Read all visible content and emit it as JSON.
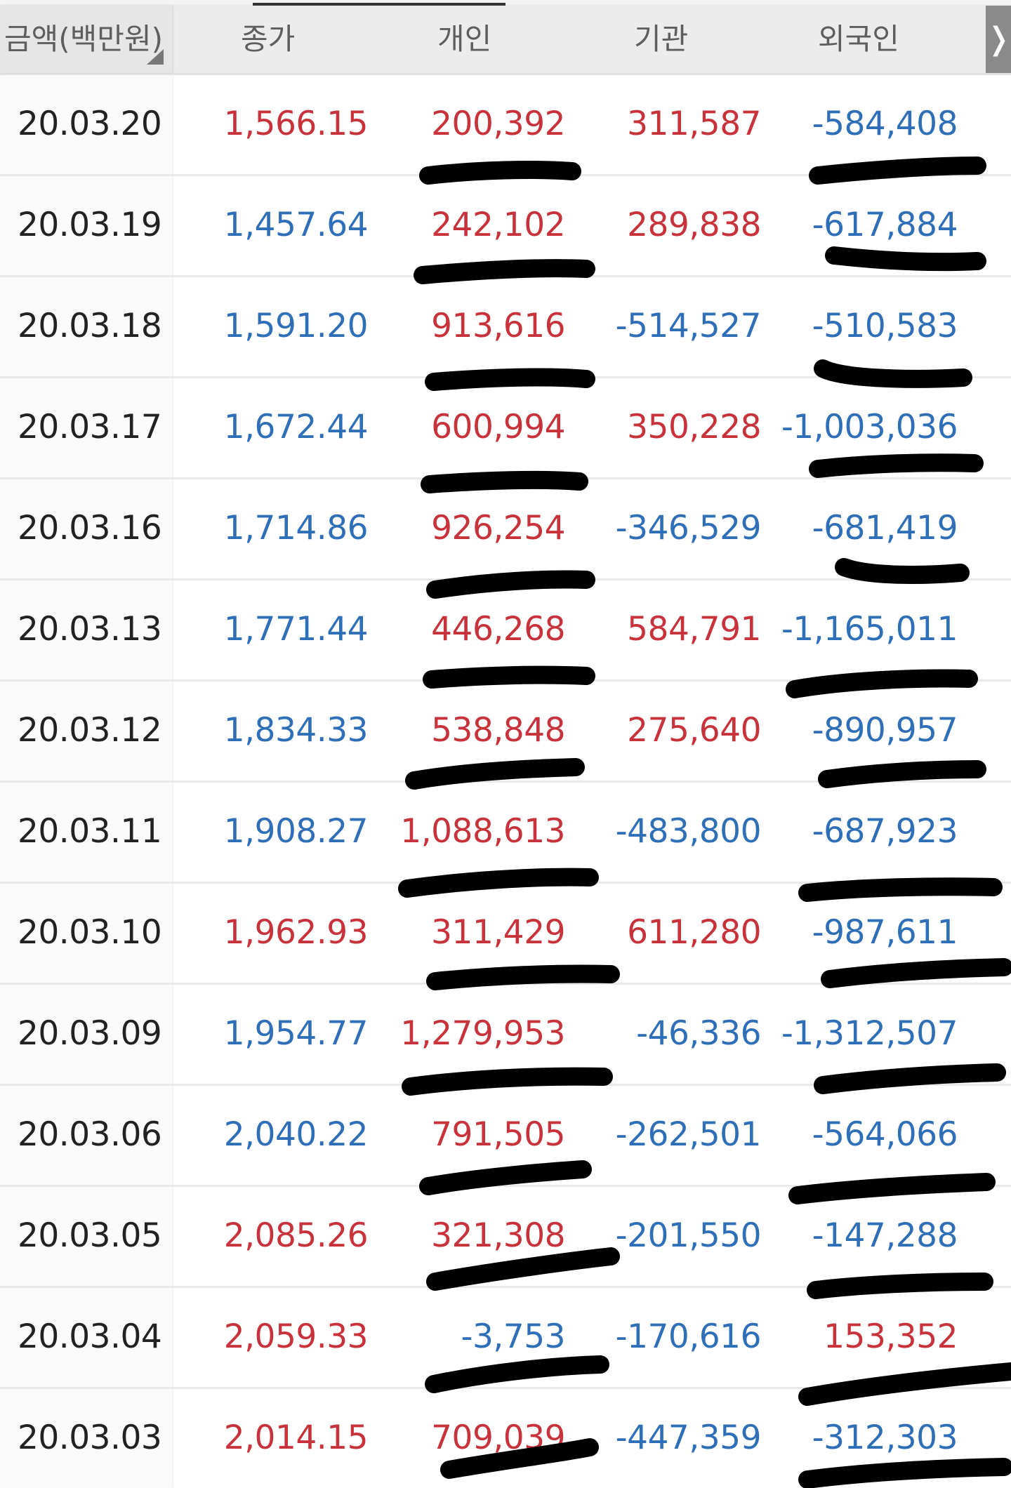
{
  "header": {
    "columns": [
      "금액(백만원)",
      "종가",
      "개인",
      "기관",
      "외국인"
    ],
    "next_glyph": "❭"
  },
  "rows": [
    {
      "date": "20.03.20",
      "close": "1,566.15",
      "individual": "200,392",
      "institution": "311,587",
      "foreign": "-584,408",
      "close_color": "red",
      "individual_color": "red",
      "institution_color": "red",
      "foreign_color": "blue"
    },
    {
      "date": "20.03.19",
      "close": "1,457.64",
      "individual": "242,102",
      "institution": "289,838",
      "foreign": "-617,884",
      "close_color": "blue",
      "individual_color": "red",
      "institution_color": "red",
      "foreign_color": "blue"
    },
    {
      "date": "20.03.18",
      "close": "1,591.20",
      "individual": "913,616",
      "institution": "-514,527",
      "foreign": "-510,583",
      "close_color": "blue",
      "individual_color": "red",
      "institution_color": "blue",
      "foreign_color": "blue"
    },
    {
      "date": "20.03.17",
      "close": "1,672.44",
      "individual": "600,994",
      "institution": "350,228",
      "foreign": "-1,003,036",
      "close_color": "blue",
      "individual_color": "red",
      "institution_color": "red",
      "foreign_color": "blue"
    },
    {
      "date": "20.03.16",
      "close": "1,714.86",
      "individual": "926,254",
      "institution": "-346,529",
      "foreign": "-681,419",
      "close_color": "blue",
      "individual_color": "red",
      "institution_color": "blue",
      "foreign_color": "blue"
    },
    {
      "date": "20.03.13",
      "close": "1,771.44",
      "individual": "446,268",
      "institution": "584,791",
      "foreign": "-1,165,011",
      "close_color": "blue",
      "individual_color": "red",
      "institution_color": "red",
      "foreign_color": "blue"
    },
    {
      "date": "20.03.12",
      "close": "1,834.33",
      "individual": "538,848",
      "institution": "275,640",
      "foreign": "-890,957",
      "close_color": "blue",
      "individual_color": "red",
      "institution_color": "red",
      "foreign_color": "blue"
    },
    {
      "date": "20.03.11",
      "close": "1,908.27",
      "individual": "1,088,613",
      "institution": "-483,800",
      "foreign": "-687,923",
      "close_color": "blue",
      "individual_color": "red",
      "institution_color": "blue",
      "foreign_color": "blue"
    },
    {
      "date": "20.03.10",
      "close": "1,962.93",
      "individual": "311,429",
      "institution": "611,280",
      "foreign": "-987,611",
      "close_color": "red",
      "individual_color": "red",
      "institution_color": "red",
      "foreign_color": "blue"
    },
    {
      "date": "20.03.09",
      "close": "1,954.77",
      "individual": "1,279,953",
      "institution": "-46,336",
      "foreign": "-1,312,507",
      "close_color": "blue",
      "individual_color": "red",
      "institution_color": "blue",
      "foreign_color": "blue"
    },
    {
      "date": "20.03.06",
      "close": "2,040.22",
      "individual": "791,505",
      "institution": "-262,501",
      "foreign": "-564,066",
      "close_color": "blue",
      "individual_color": "red",
      "institution_color": "blue",
      "foreign_color": "blue"
    },
    {
      "date": "20.03.05",
      "close": "2,085.26",
      "individual": "321,308",
      "institution": "-201,550",
      "foreign": "-147,288",
      "close_color": "red",
      "individual_color": "red",
      "institution_color": "blue",
      "foreign_color": "blue"
    },
    {
      "date": "20.03.04",
      "close": "2,059.33",
      "individual": "-3,753",
      "institution": "-170,616",
      "foreign": "153,352",
      "close_color": "red",
      "individual_color": "blue",
      "institution_color": "blue",
      "foreign_color": "red"
    },
    {
      "date": "20.03.03",
      "close": "2,014.15",
      "individual": "709,039",
      "institution": "-447,359",
      "foreign": "-312,303",
      "close_color": "red",
      "individual_color": "red",
      "institution_color": "blue",
      "foreign_color": "blue"
    }
  ],
  "colors": {
    "positive": "#c8323b",
    "negative": "#2f6fb8",
    "date": "#222222",
    "header_text": "#5e5e5e"
  }
}
